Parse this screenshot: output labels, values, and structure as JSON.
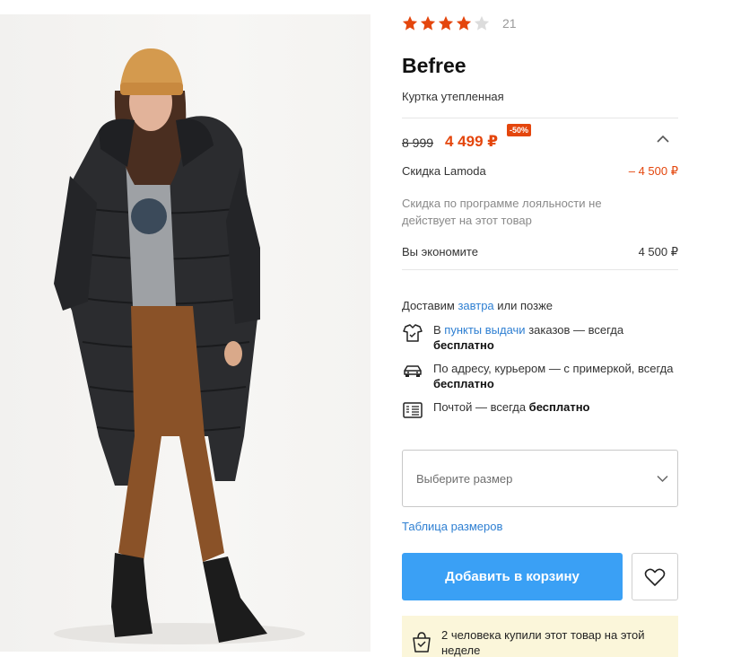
{
  "rating": {
    "value": 4,
    "max": 5,
    "count": "21",
    "colors": {
      "filled": "#e4460d",
      "empty": "#dcdcdc"
    }
  },
  "product": {
    "brand": "Befree",
    "subtitle": "Куртка утепленная",
    "image_icon": "product-photo"
  },
  "price": {
    "old": "8 999",
    "new": "4 499 ₽",
    "badge": "-50%",
    "lamoda_discount_label": "Скидка Lamoda",
    "lamoda_discount_value": "– 4 500 ₽",
    "loyalty_note": "Скидка по программе лояльности не действует на этот товар",
    "savings_label": "Вы экономите",
    "savings_value": "4 500 ₽"
  },
  "delivery": {
    "head_prefix": "Доставим ",
    "head_link": "завтра",
    "head_suffix": " или позже",
    "items": [
      {
        "icon": "pickup-point-icon",
        "prefix": "В ",
        "link": "пункты выдачи",
        "mid": " заказов — всегда ",
        "bold": "бесплатно"
      },
      {
        "icon": "courier-car-icon",
        "prefix": "По адресу, курьером — с примеркой, всегда ",
        "bold": "бесплатно"
      },
      {
        "icon": "post-icon",
        "prefix": "Почтой — всегда ",
        "bold": "бесплатно"
      }
    ]
  },
  "size": {
    "placeholder": "Выберите размер",
    "table_link": "Таблица размеров"
  },
  "actions": {
    "add_to_cart": "Добавить в корзину",
    "favorite_icon": "heart-icon"
  },
  "promo": {
    "text": "2 человека купили этот товар на этой неделе",
    "icon": "shopping-bag-icon"
  },
  "colors": {
    "accent": "#e4460d",
    "button": "#3aa0f5",
    "link": "#2e7fd2",
    "promo_bg": "#fbf6da"
  }
}
